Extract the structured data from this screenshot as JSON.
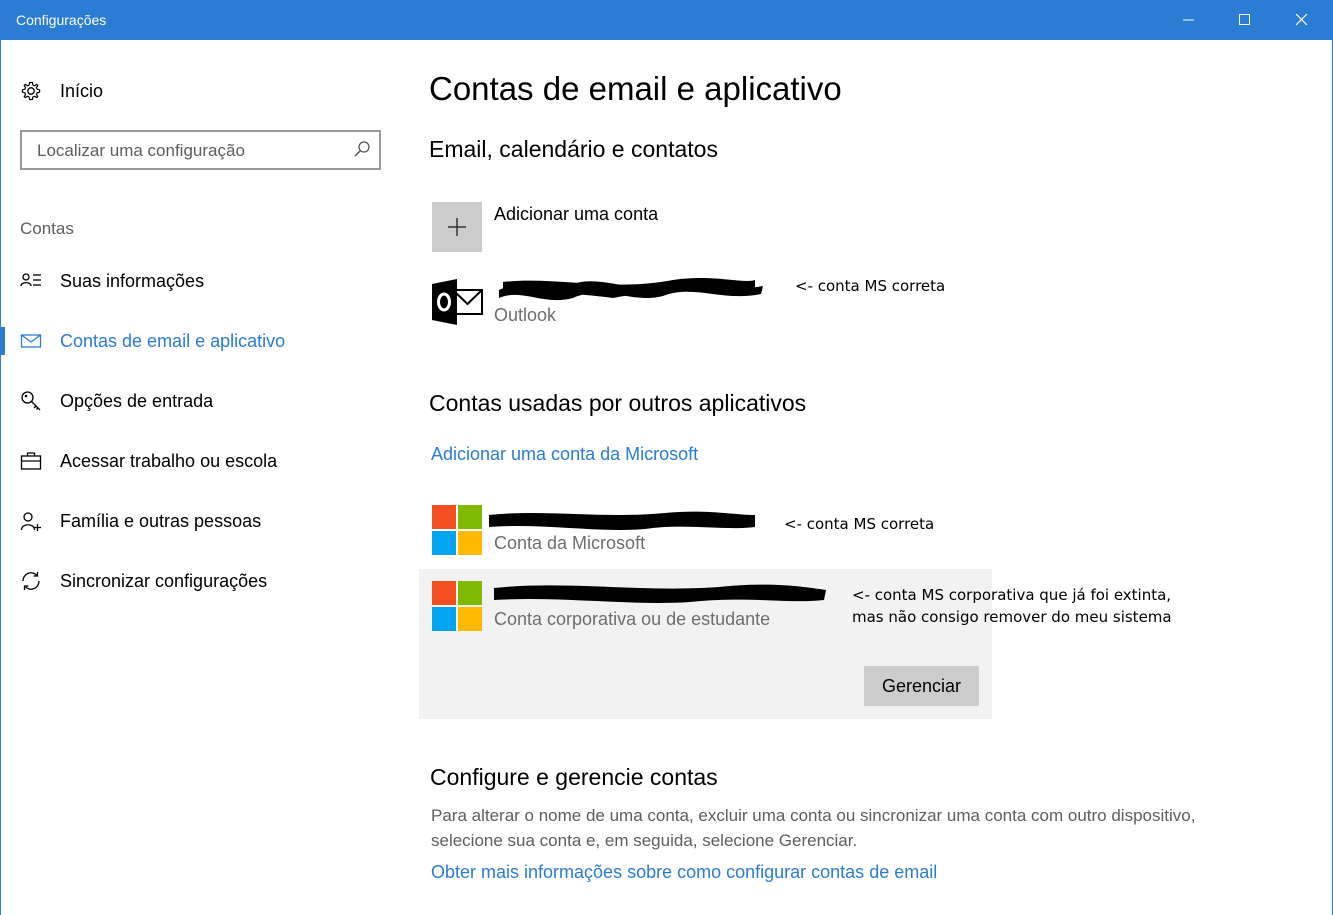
{
  "window": {
    "title": "Configurações",
    "controls": [
      "minimize-icon",
      "maximize-icon",
      "close-icon"
    ]
  },
  "sidebar": {
    "home_label": "Início",
    "search_placeholder": "Localizar uma configuração",
    "section_label": "Contas",
    "items": [
      {
        "label": "Suas informações",
        "icon": "user-info-icon",
        "active": false
      },
      {
        "label": "Contas de email e aplicativo",
        "icon": "mail-icon",
        "active": true
      },
      {
        "label": "Opções de entrada",
        "icon": "key-icon",
        "active": false
      },
      {
        "label": "Acessar trabalho ou escola",
        "icon": "briefcase-icon",
        "active": false
      },
      {
        "label": "Família e outras pessoas",
        "icon": "add-person-icon",
        "active": false
      },
      {
        "label": "Sincronizar configurações",
        "icon": "sync-icon",
        "active": false
      }
    ]
  },
  "main": {
    "title": "Contas de email e aplicativo",
    "email_section": {
      "heading": "Email, calendário e contatos",
      "add_account_label": "Adicionar uma conta",
      "accounts": [
        {
          "type": "Outlook",
          "note": "<- conta MS correta",
          "icon": "outlook-icon"
        }
      ]
    },
    "other_apps_section": {
      "heading": "Contas usadas por outros aplicativos",
      "add_ms_account_link": "Adicionar uma conta da Microsoft",
      "accounts": [
        {
          "type": "Conta da Microsoft",
          "note": "<- conta MS correta",
          "icon": "microsoft-logo-icon"
        },
        {
          "type": "Conta corporativa ou de estudante",
          "note_line1": "<- conta MS corporativa que já foi extinta,",
          "note_line2": "mas não consigo remover do meu sistema",
          "icon": "microsoft-logo-icon",
          "selected": true
        }
      ],
      "manage_button": "Gerenciar"
    },
    "configure_section": {
      "heading": "Configure e gerencie contas",
      "description_line1": "Para alterar o nome de uma conta, excluir uma conta ou sincronizar uma conta com outro dispositivo,",
      "description_line2": "selecione sua conta e, em seguida, selecione Gerenciar.",
      "more_info_link": "Obter mais informações sobre como configurar contas de email"
    }
  },
  "colors": {
    "accent": "#2b7cd3",
    "ms_red": "#f25022",
    "ms_green": "#7fba00",
    "ms_blue": "#00a4ef",
    "ms_yellow": "#ffb900"
  }
}
